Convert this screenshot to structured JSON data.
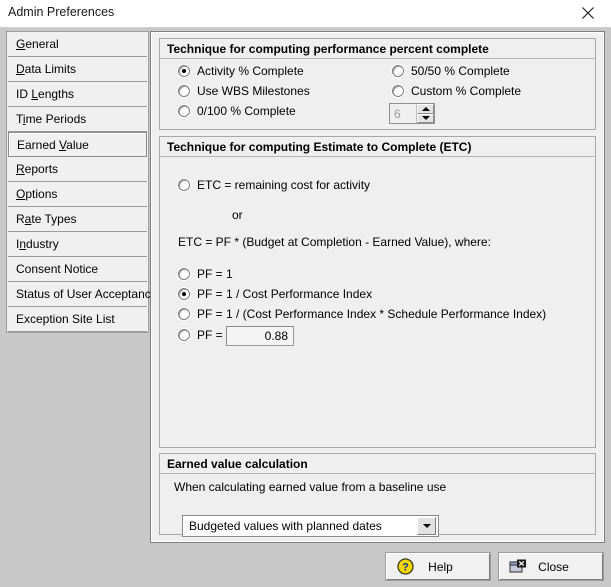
{
  "window": {
    "title": "Admin Preferences",
    "close_icon": "close-x-icon"
  },
  "sidebar": {
    "items": [
      {
        "label": "General",
        "accel": "G",
        "selected": false
      },
      {
        "label": "Data Limits",
        "accel": "D",
        "selected": false
      },
      {
        "label": "ID Lengths",
        "accel": "L",
        "selected": false
      },
      {
        "label": "Time Periods",
        "accel": "i",
        "selected": false
      },
      {
        "label": "Earned Value",
        "accel": "V",
        "selected": true
      },
      {
        "label": "Reports",
        "accel": "R",
        "selected": false
      },
      {
        "label": "Options",
        "accel": "O",
        "selected": false
      },
      {
        "label": "Rate Types",
        "accel": "a",
        "selected": false
      },
      {
        "label": "Industry",
        "accel": "n",
        "selected": false
      },
      {
        "label": "Consent Notice",
        "accel": "",
        "selected": false
      },
      {
        "label": "Status of User Acceptance",
        "accel": "",
        "selected": false
      },
      {
        "label": "Exception Site List",
        "accel": "",
        "selected": false
      }
    ]
  },
  "technique_group": {
    "title": "Technique for computing performance percent complete",
    "options": [
      {
        "label": "Activity % Complete",
        "checked": true,
        "enabled": true
      },
      {
        "label": "Use WBS Milestones",
        "checked": false,
        "enabled": true
      },
      {
        "label": "0/100 % Complete",
        "checked": false,
        "enabled": true
      },
      {
        "label": "50/50 % Complete",
        "checked": false,
        "enabled": true
      },
      {
        "label": "Custom % Complete",
        "checked": false,
        "enabled": true
      }
    ],
    "spinner": {
      "value": "6",
      "enabled": false
    }
  },
  "etc_group": {
    "title": "Technique for computing Estimate to Complete (ETC)",
    "first_option": {
      "label": "ETC = remaining cost for activity",
      "checked": false
    },
    "or_text": "or",
    "formula_text": "ETC = PF * (Budget at Completion - Earned Value), where:",
    "pf_options": [
      {
        "label": "PF = 1",
        "checked": false
      },
      {
        "label": "PF = 1 / Cost Performance Index",
        "checked": true
      },
      {
        "label": "PF = 1 / (Cost Performance Index * Schedule Performance Index)",
        "checked": false
      }
    ],
    "pf_custom": {
      "label": "PF =",
      "checked": false,
      "value": "0.88"
    }
  },
  "evc_group": {
    "title": "Earned value calculation",
    "description": "When calculating earned value from a baseline use",
    "dropdown": {
      "value": "Budgeted values with planned dates",
      "arrow_icon": "chevron-down-icon"
    }
  },
  "footer": {
    "help": {
      "label": "Help",
      "icon": "question-mark-icon"
    },
    "close": {
      "label": "Close",
      "icon": "close-window-icon"
    }
  }
}
